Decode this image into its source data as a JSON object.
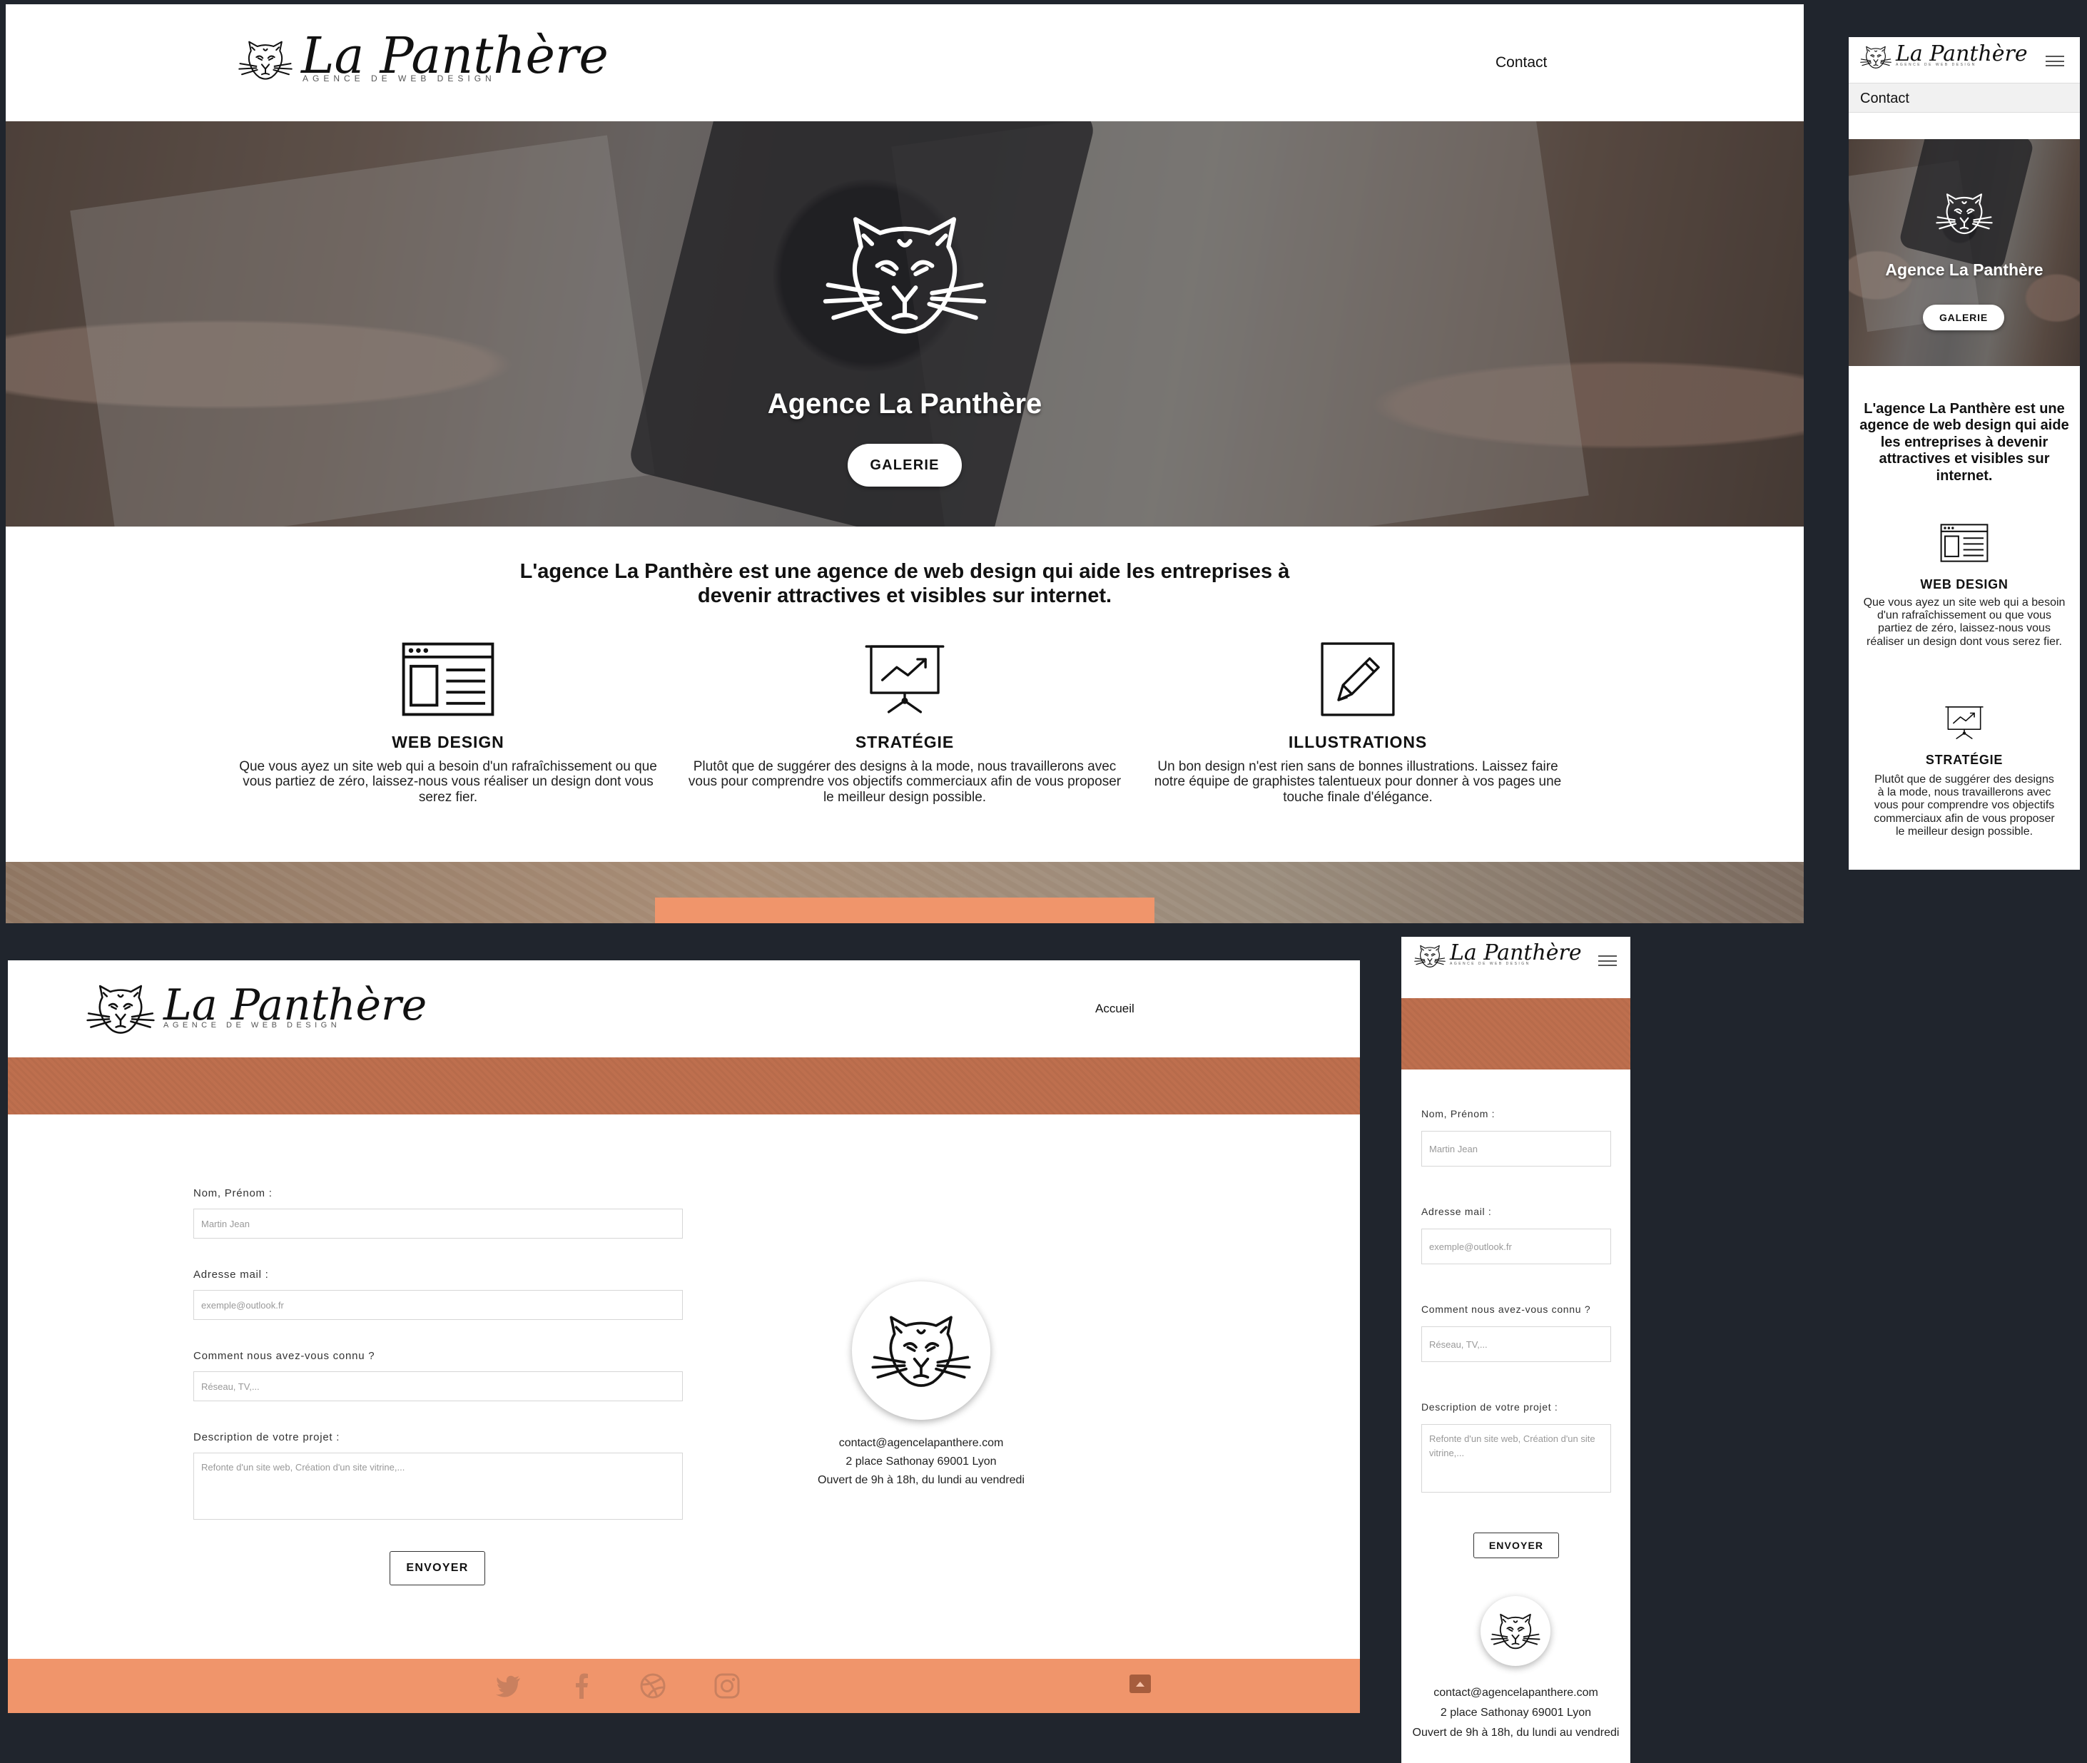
{
  "brand": {
    "name": "La Panthère",
    "tagline": "AGENCE DE WEB DESIGN"
  },
  "home": {
    "nav": {
      "contact": "Contact"
    },
    "hero": {
      "title": "Agence La Panthère",
      "button": "GALERIE"
    },
    "intro": "L'agence La Panthère est une agence de web design qui aide les entreprises à devenir attractives et visibles sur internet.",
    "services": [
      {
        "icon": "web-design-icon",
        "title": "WEB DESIGN",
        "text": "Que vous ayez un site web qui a besoin d'un rafraîchissement ou que vous partiez de zéro, laissez-nous vous réaliser un design dont vous serez fier."
      },
      {
        "icon": "strategy-icon",
        "title": "STRATÉGIE",
        "text": "Plutôt que de suggérer des designs à la mode, nous travaillerons avec vous pour comprendre vos objectifs commerciaux afin de vous proposer le meilleur design possible."
      },
      {
        "icon": "illustration-icon",
        "title": "ILLUSTRATIONS",
        "text": "Un bon design n'est rien sans de bonnes illustrations. Laissez faire notre équipe de graphistes talentueux pour donner à vos pages une touche finale d'élégance."
      }
    ]
  },
  "contact_page": {
    "nav": {
      "home": "Accueil"
    },
    "form": {
      "name_label": "Nom, Prénom :",
      "name_placeholder": "Martin Jean",
      "email_label": "Adresse mail :",
      "email_placeholder": "exemple@outlook.fr",
      "source_label": "Comment nous avez-vous connu ?",
      "source_placeholder": "Réseau, TV,...",
      "project_label": "Description de votre projet :",
      "project_placeholder": "Refonte d'un site web, Création d'un site vitrine,...",
      "submit": "ENVOYER"
    },
    "info": {
      "email": "contact@agencelapanthere.com",
      "address": "2 place Sathonay 69001 Lyon",
      "hours": "Ouvert de 9h à 18h, du lundi au vendredi"
    },
    "footer": {
      "social": [
        "twitter-icon",
        "facebook-icon",
        "dribbble-icon",
        "instagram-icon"
      ]
    }
  },
  "colors": {
    "accent": "#f0956b",
    "terracotta": "#be6f4e",
    "background": "#20252d"
  }
}
